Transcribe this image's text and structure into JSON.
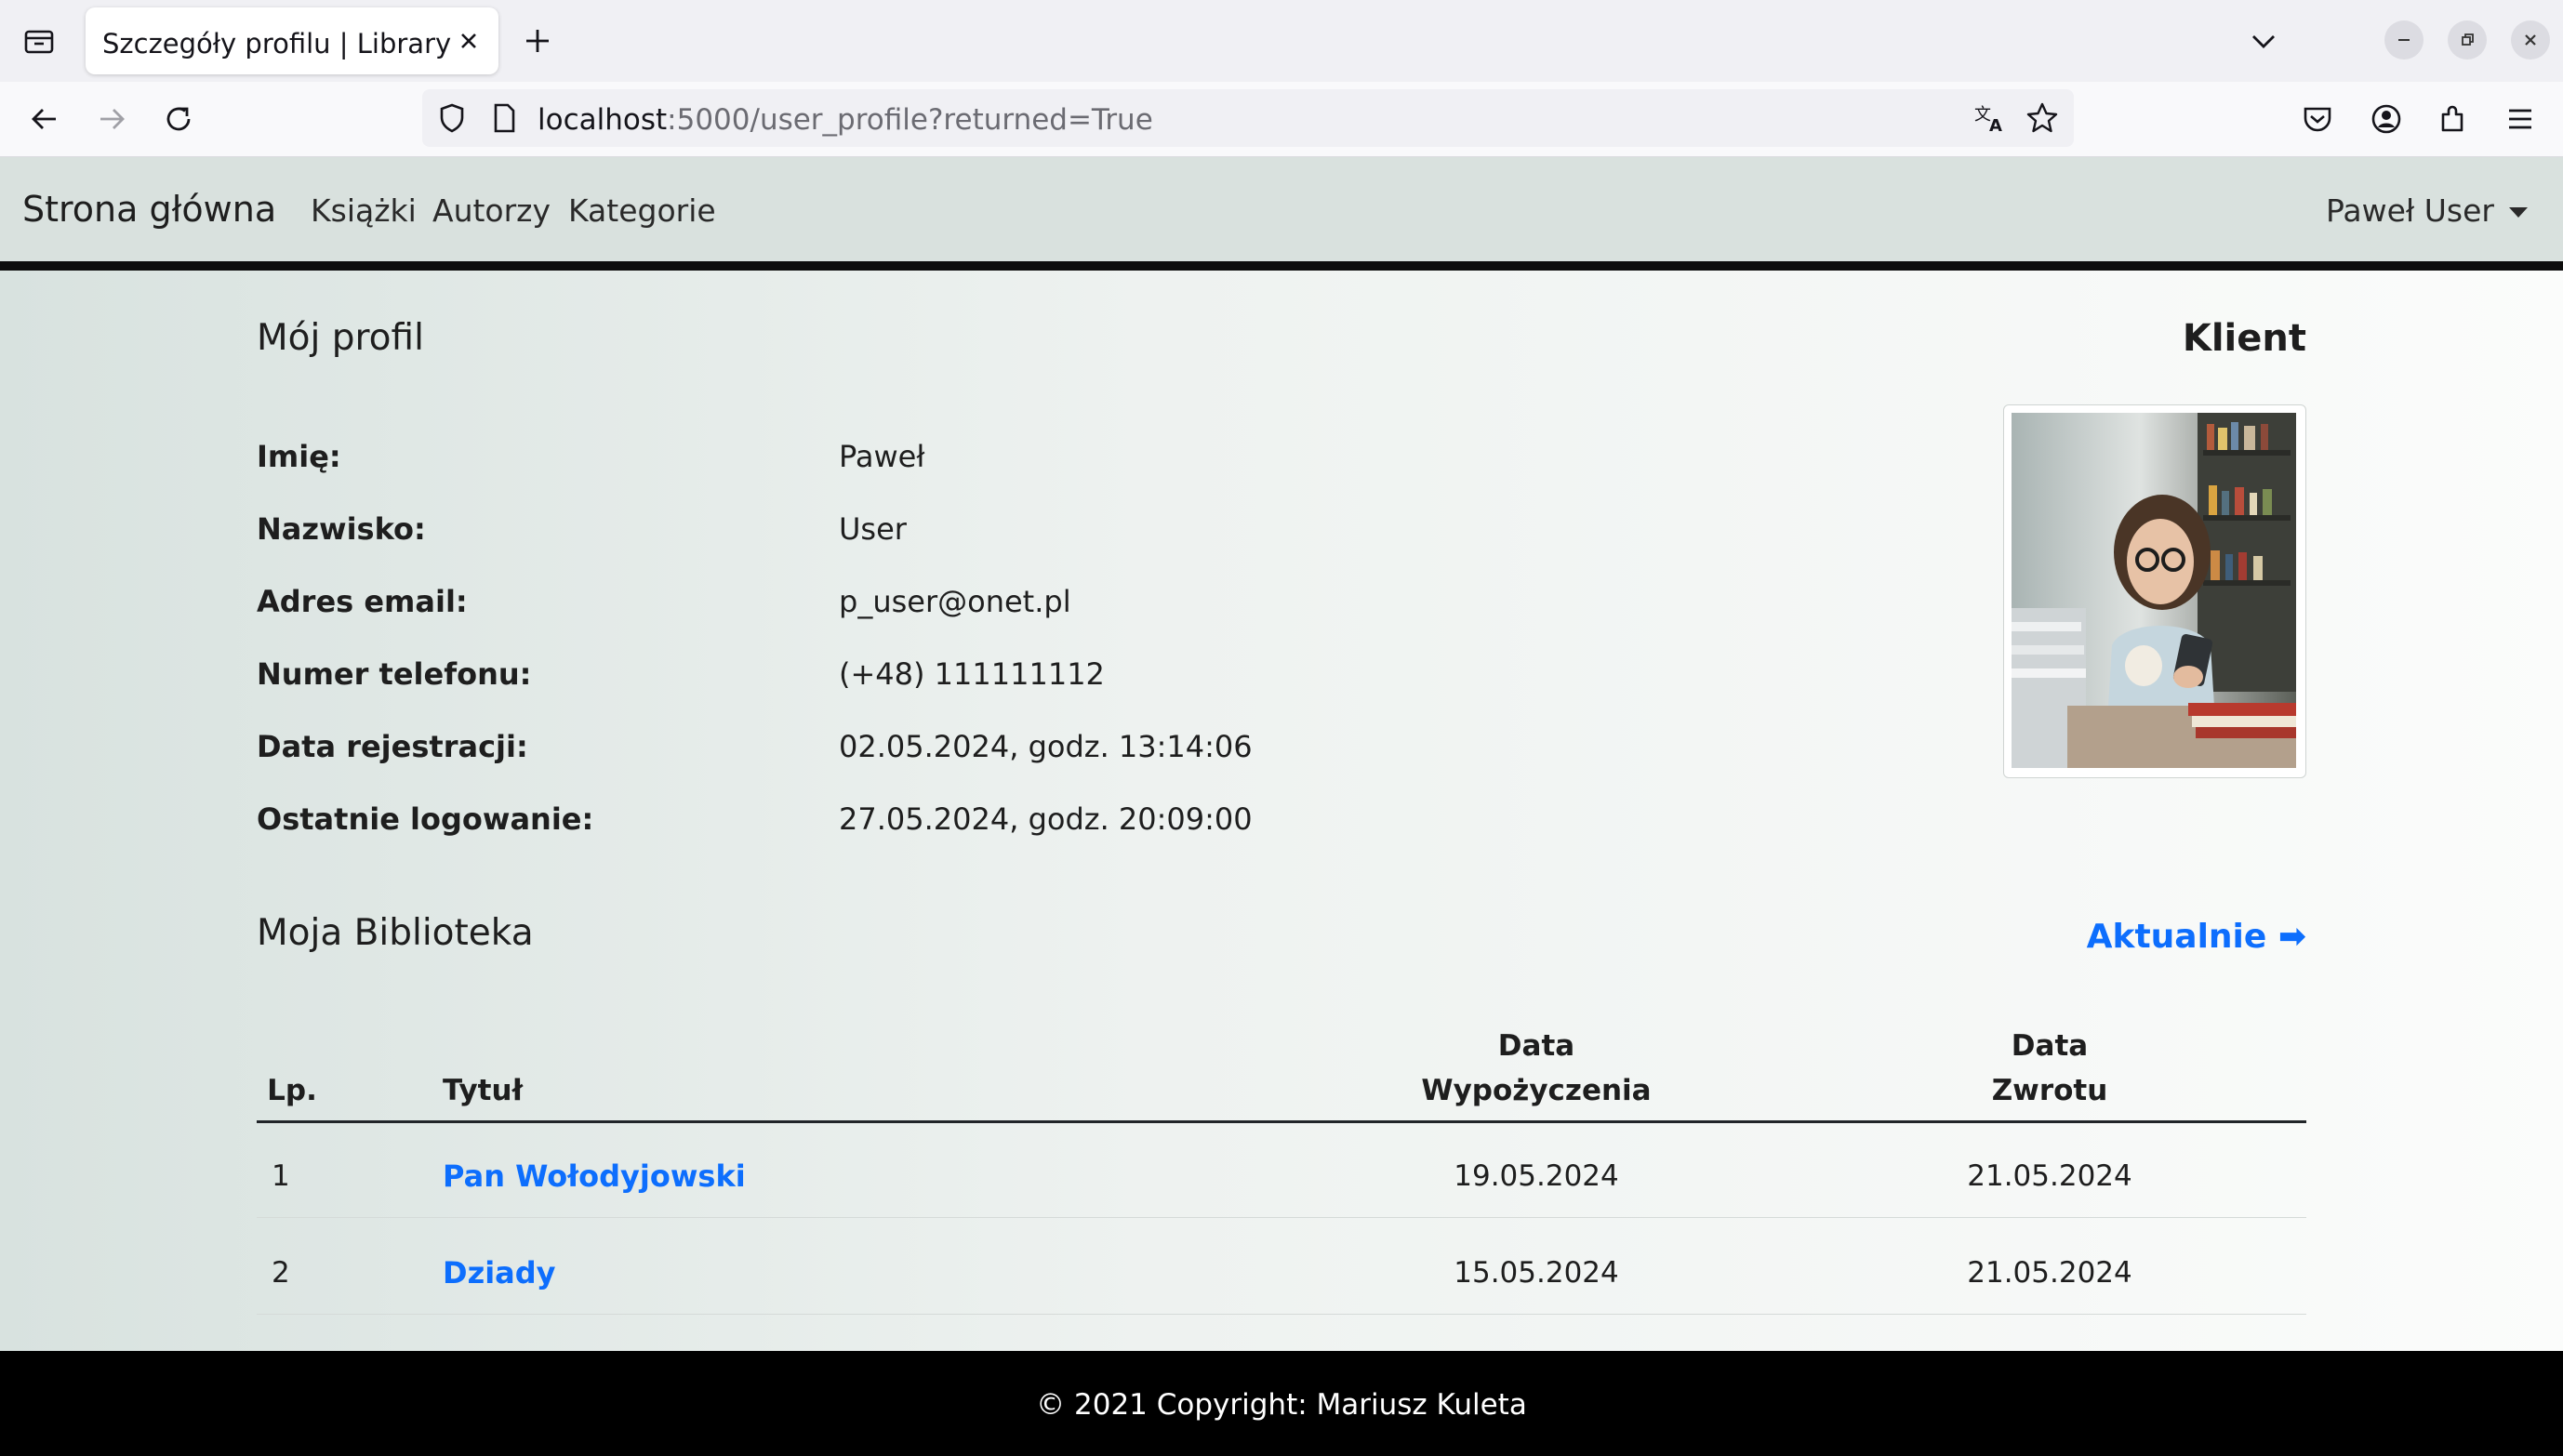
{
  "browser": {
    "tab_title": "Szczegóły profilu | Library",
    "url_host": "localhost",
    "url_rest": ":5000/user_profile?returned=True"
  },
  "navbar": {
    "brand": "Strona główna",
    "links": [
      "Książki",
      "Autorzy",
      "Kategorie"
    ],
    "user": "Paweł User"
  },
  "profile": {
    "heading": "Mój profil",
    "role": "Klient",
    "fields": [
      {
        "label": "Imię:",
        "value": "Paweł"
      },
      {
        "label": "Nazwisko:",
        "value": "User"
      },
      {
        "label": "Adres email:",
        "value": "p_user@onet.pl"
      },
      {
        "label": "Numer telefonu:",
        "value": "(+48) 111111112"
      },
      {
        "label": "Data rejestracji:",
        "value": "02.05.2024, godz. 13:14:06"
      },
      {
        "label": "Ostatnie logowanie:",
        "value": "27.05.2024, godz. 20:09:00"
      }
    ]
  },
  "library": {
    "heading": "Moja Biblioteka",
    "current_link": "Aktualnie ➡",
    "columns": {
      "lp": "Lp.",
      "title": "Tytuł",
      "borrow_1": "Data",
      "borrow_2": "Wypożyczenia",
      "return_1": "Data",
      "return_2": "Zwrotu"
    },
    "rows": [
      {
        "lp": "1",
        "title": "Pan Wołodyjowski",
        "borrowed": "19.05.2024",
        "returned": "21.05.2024"
      },
      {
        "lp": "2",
        "title": "Dziady",
        "borrowed": "15.05.2024",
        "returned": "21.05.2024"
      }
    ]
  },
  "footer": {
    "text": "© 2021 Copyright: Mariusz Kuleta"
  },
  "colors": {
    "link": "#0d6efd",
    "navbar_bg": "#d9e1de",
    "footer_bg": "#000000"
  }
}
